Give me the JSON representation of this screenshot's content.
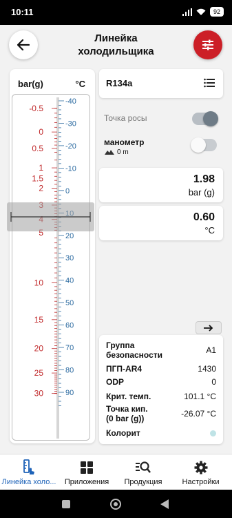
{
  "status": {
    "time": "10:11",
    "battery": "92"
  },
  "header": {
    "title_line1": "Линейка",
    "title_line2": "холодильщика"
  },
  "ruler": {
    "unit_pressure": "bar(g)",
    "unit_temp": "°C",
    "pressure_labels": [
      {
        "t": "-0.5",
        "v": -0.5
      },
      {
        "t": "0",
        "v": 0
      },
      {
        "t": "0.5",
        "v": 0.5
      },
      {
        "t": "1",
        "v": 1
      },
      {
        "t": "1.5",
        "v": 1.5
      },
      {
        "t": "2",
        "v": 2
      },
      {
        "t": "3",
        "v": 3
      },
      {
        "t": "4",
        "v": 4
      },
      {
        "t": "5",
        "v": 5
      },
      {
        "t": "10",
        "v": 10
      },
      {
        "t": "15",
        "v": 15
      },
      {
        "t": "20",
        "v": 20
      },
      {
        "t": "25",
        "v": 25
      },
      {
        "t": "30",
        "v": 30
      }
    ],
    "temp_labels": [
      "-40",
      "-30",
      "-20",
      "-10",
      "0",
      "10",
      "20",
      "30",
      "40",
      "50",
      "60",
      "70",
      "80",
      "90"
    ],
    "temp_values": [
      -40,
      -30,
      -20,
      -10,
      0,
      10,
      20,
      30,
      40,
      50,
      60,
      70,
      80,
      90
    ],
    "pressure_color": "#c0292b",
    "temp_color": "#2b6aa0"
  },
  "refrigerant": {
    "name": "R134a"
  },
  "dew_point": {
    "label": "Точка росы",
    "state": "on"
  },
  "manometer": {
    "label": "манометр",
    "altitude": "0 m",
    "state": "off"
  },
  "pressure": {
    "value": "1.98",
    "unit": "bar (g)"
  },
  "temperature": {
    "value": "0.60",
    "unit": "°C"
  },
  "properties": {
    "safety_group_l1": "Группа",
    "safety_group_l2": "безопасности",
    "safety_group_v": "A1",
    "gwp_k": "ПГП-AR4",
    "gwp_v": "1430",
    "odp_k": "ODP",
    "odp_v": "0",
    "crit_k": "Крит. темп.",
    "crit_v": "101.1 °C",
    "boil_l1": "Точка кип.",
    "boil_l2": "(0 bar (g))",
    "boil_v": "-26.07 °C",
    "color_k": "Колорит",
    "color_swatch": "#bfe3e6"
  },
  "nav": {
    "ruler": "Линейка холо...",
    "apps": "Приложения",
    "products": "Продукция",
    "settings": "Настройки"
  },
  "colors": {
    "accent": "#cc1f27",
    "active_nav": "#1e63b8"
  }
}
